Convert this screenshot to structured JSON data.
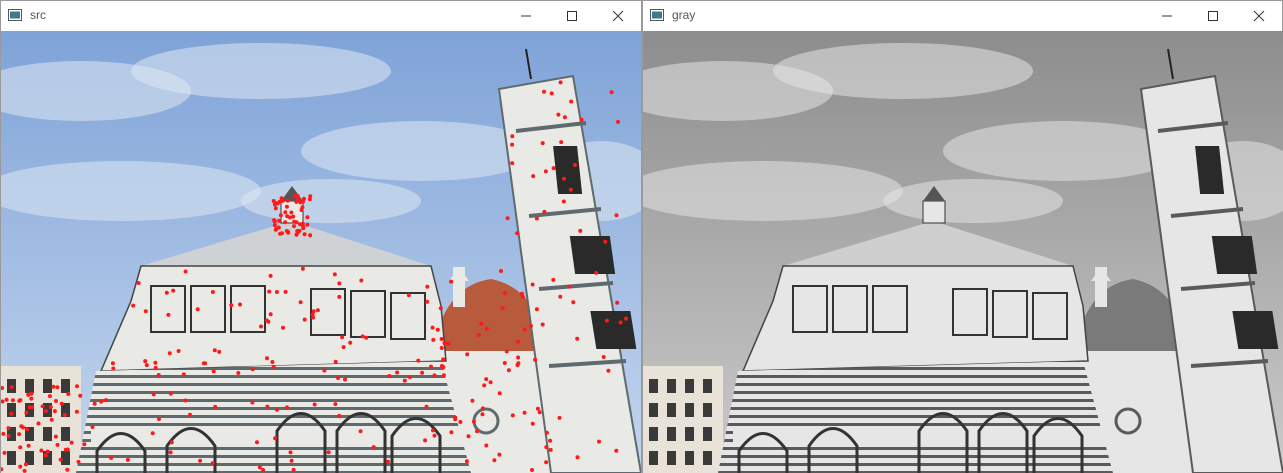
{
  "windows": [
    {
      "title": "src",
      "colors": {
        "sky": "#7fa3d8",
        "sky_light": "#c4d6ee",
        "cloud": "#dfe7f2",
        "marble": "#e9e9e6",
        "stripe": "#5e6a6e",
        "dome": "#b85a3c",
        "roof": "#cfd2d4",
        "keypoint": "#ff1a1a"
      },
      "has_keypoints": true
    },
    {
      "title": "gray",
      "colors": {
        "sky": "#8d8d8d",
        "sky_light": "#cbcbcb",
        "cloud": "#e4e4e4",
        "marble": "#e6e6e6",
        "stripe": "#5a5a5a",
        "dome": "#7a7a7a",
        "roof": "#cfcfcf"
      },
      "has_keypoints": false
    }
  ],
  "controls": {
    "minimize": "minimize-icon",
    "maximize": "maximize-icon",
    "close": "close-icon"
  }
}
